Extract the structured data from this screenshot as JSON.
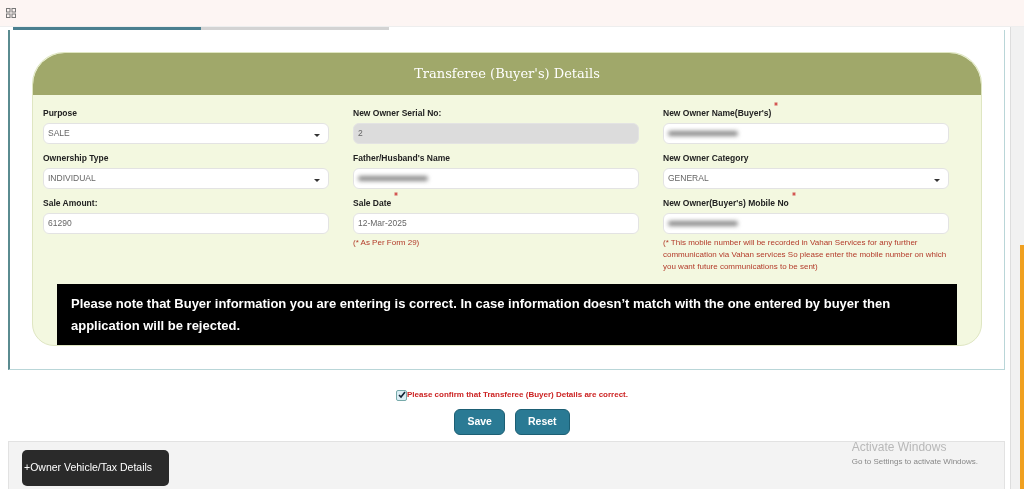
{
  "tabs": [
    {
      "selected": true
    },
    {
      "selected": false
    }
  ],
  "section": {
    "title": "Transferee (Buyer's) Details",
    "columns": [
      [
        {
          "label": "Purpose",
          "kind": "select",
          "value": "SALE"
        },
        {
          "label": "Ownership Type",
          "kind": "select",
          "value": "INDIVIDUAL"
        },
        {
          "label": "Sale Amount:",
          "kind": "text",
          "value": "61290"
        }
      ],
      [
        {
          "label": "New Owner Serial No:",
          "kind": "text",
          "value": "2",
          "disabled": true
        },
        {
          "label": "Father/Husband's Name",
          "kind": "redacted"
        },
        {
          "label": "Sale Date",
          "required": true,
          "kind": "text",
          "value": "12-Mar-2025",
          "note": "(* As Per Form 29)"
        }
      ],
      [
        {
          "label": "New Owner Name(Buyer's)",
          "required": true,
          "kind": "redacted"
        },
        {
          "label": "New Owner Category",
          "kind": "select",
          "value": "GENERAL"
        },
        {
          "label": "New Owner(Buyer's) Mobile No",
          "required": true,
          "kind": "redacted",
          "note": "(* This mobile number will be recorded in Vahan Services for any further communication via Vahan services So please enter the mobile number on which you want future communications to be sent)"
        }
      ]
    ],
    "notice": "Please note that Buyer information you are entering is correct. In case information doesn’t match with the one entered by buyer then application will be rejected."
  },
  "confirm": {
    "label": "Please confirm that Transferee (Buyer) Details are correct.",
    "checked": true
  },
  "buttons": [
    "Save",
    "Reset"
  ],
  "collapsed_panel": {
    "label": "+Owner Vehicle/Tax Details"
  },
  "os_watermark": {
    "title": "Activate Windows",
    "subtitle": "Go to Settings to activate Windows."
  }
}
